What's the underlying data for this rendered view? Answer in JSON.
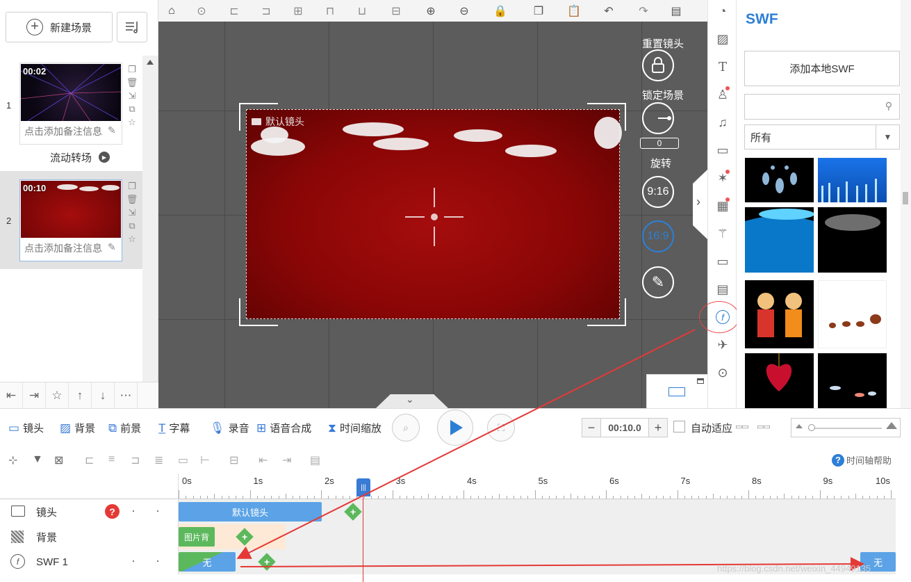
{
  "left_panel": {
    "new_scene_label": "新建场景",
    "scenes": [
      {
        "index": "1",
        "time": "00:02",
        "note": "点击添加备注信息",
        "transition": "流动转场"
      },
      {
        "index": "2",
        "time": "00:10",
        "note": "点击添加备注信息"
      }
    ]
  },
  "stage": {
    "camera_label": "默认镜头",
    "reset_label": "重置镜头",
    "lock_label": "锁定场景",
    "rotate_value": "0",
    "rotate_label": "旋转",
    "ratio_916": "9:16",
    "ratio_169": "16:9"
  },
  "swf_panel": {
    "title": "SWF",
    "add_local_label": "添加本地SWF",
    "search_placeholder": "",
    "filter_value": "所有"
  },
  "lower_tabs": {
    "camera": "镜头",
    "background": "背景",
    "foreground": "前景",
    "subtitle": "字幕",
    "record": "录音",
    "tts": "语音合成",
    "time_scale": "时间缩放"
  },
  "playback": {
    "duration": "00:10.0",
    "minus": "−",
    "plus": "+",
    "auto_fit_label": "自动适应"
  },
  "help_label": "时间轴帮助",
  "timeline": {
    "ruler_labels": [
      "0s",
      "1s",
      "2s",
      "3s",
      "4s",
      "5s",
      "6s",
      "7s",
      "8s",
      "9s",
      "10s"
    ],
    "tracks": [
      {
        "name": "镜头",
        "clip": "默认镜头"
      },
      {
        "name": "背景",
        "clip": "图片背"
      },
      {
        "name": "SWF 1",
        "clip": "无",
        "end_clip": "无"
      }
    ]
  },
  "watermark": "https://blog.csdn.net/weixin_44949135",
  "colors": {
    "accent": "#2d7fd6",
    "stage_bg": "#5c5c5c",
    "scene_red": "#8a0606",
    "clip_blue": "#5ba3e6",
    "clip_green": "#5cb85c",
    "annotation_red": "#e53935"
  }
}
